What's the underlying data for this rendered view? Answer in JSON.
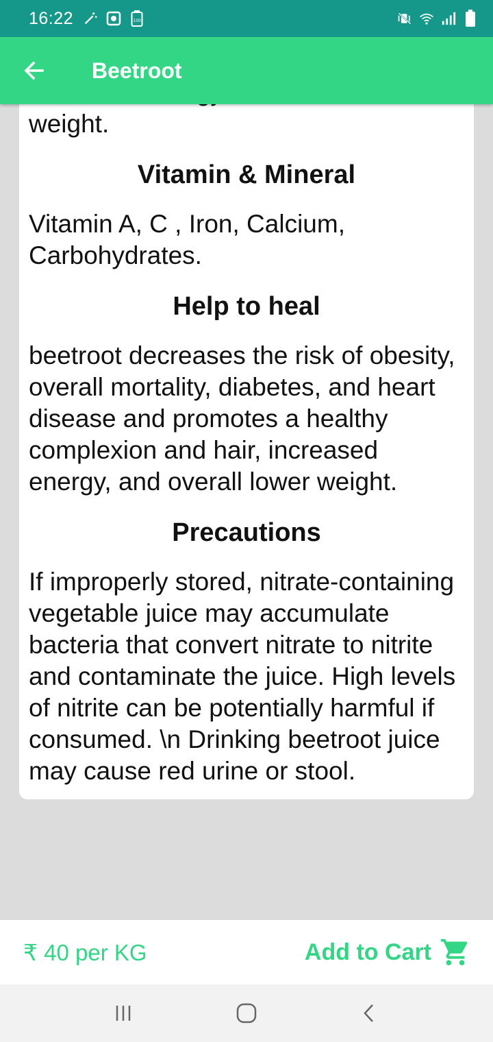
{
  "status_bar": {
    "time": "16:22",
    "left_icons": [
      "magic-wand-icon",
      "screen-record-icon",
      "battery-saver-icon"
    ],
    "right_icons": [
      "vibrate-mute-icon",
      "wifi-icon",
      "signal-icon",
      "battery-icon"
    ]
  },
  "app_bar": {
    "title": "Beetroot",
    "back_icon": "arrow-left-icon",
    "color": "#32d684"
  },
  "content": {
    "intro_tail": "increased energy, and overall lower weight.",
    "sections": [
      {
        "heading": "Vitamin & Mineral",
        "body": "Vitamin A, C , Iron, Calcium, Carbohydrates."
      },
      {
        "heading": "Help to heal",
        "body": "beetroot decreases the risk of obesity, overall mortality, diabetes, and heart disease and promotes a healthy complexion and hair, increased energy, and overall lower weight."
      },
      {
        "heading": "Precautions",
        "body": "If improperly stored, nitrate-containing vegetable juice may accumulate bacteria that convert nitrate to nitrite and contaminate the juice. High levels of nitrite can be potentially harmful if consumed. \\n Drinking beetroot juice may cause red urine or stool."
      }
    ]
  },
  "bottom_bar": {
    "price": "₹ 40 per KG",
    "cart_label": "Add to Cart",
    "cart_icon": "cart-icon"
  },
  "nav_bar": {
    "buttons": [
      "recent-apps-icon",
      "home-icon",
      "back-icon"
    ]
  },
  "colors": {
    "status_bar": "#15988a",
    "accent": "#32d684",
    "background": "#dcdcdc"
  }
}
